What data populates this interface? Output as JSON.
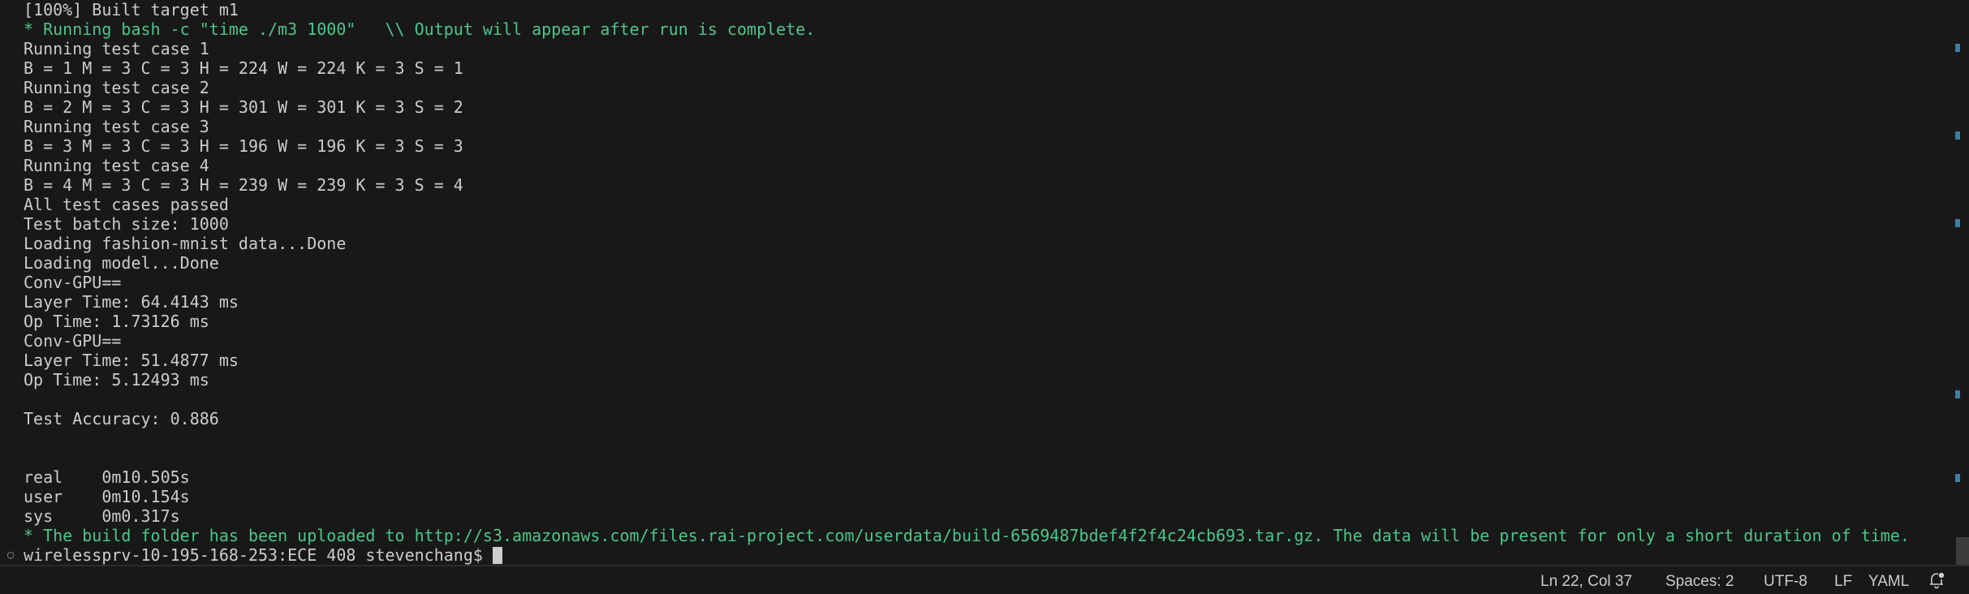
{
  "terminal": {
    "lines": [
      {
        "text": "[100%] Built target m1",
        "color": "default"
      },
      {
        "text": "* Running bash -c \"time ./m3 1000\"   \\\\ Output will appear after run is complete.",
        "color": "green"
      },
      {
        "text": "Running test case 1",
        "color": "default"
      },
      {
        "text": "B = 1 M = 3 C = 3 H = 224 W = 224 K = 3 S = 1",
        "color": "default"
      },
      {
        "text": "Running test case 2",
        "color": "default"
      },
      {
        "text": "B = 2 M = 3 C = 3 H = 301 W = 301 K = 3 S = 2",
        "color": "default"
      },
      {
        "text": "Running test case 3",
        "color": "default"
      },
      {
        "text": "B = 3 M = 3 C = 3 H = 196 W = 196 K = 3 S = 3",
        "color": "default"
      },
      {
        "text": "Running test case 4",
        "color": "default"
      },
      {
        "text": "B = 4 M = 3 C = 3 H = 239 W = 239 K = 3 S = 4",
        "color": "default"
      },
      {
        "text": "All test cases passed",
        "color": "default"
      },
      {
        "text": "Test batch size: 1000",
        "color": "default"
      },
      {
        "text": "Loading fashion-mnist data...Done",
        "color": "default"
      },
      {
        "text": "Loading model...Done",
        "color": "default"
      },
      {
        "text": "Conv-GPU==",
        "color": "default"
      },
      {
        "text": "Layer Time: 64.4143 ms",
        "color": "default"
      },
      {
        "text": "Op Time: 1.73126 ms",
        "color": "default"
      },
      {
        "text": "Conv-GPU==",
        "color": "default"
      },
      {
        "text": "Layer Time: 51.4877 ms",
        "color": "default"
      },
      {
        "text": "Op Time: 5.12493 ms",
        "color": "default"
      },
      {
        "text": "",
        "color": "default"
      },
      {
        "text": "Test Accuracy: 0.886",
        "color": "default"
      },
      {
        "text": "",
        "color": "default"
      },
      {
        "text": "",
        "color": "default"
      },
      {
        "text": "real    0m10.505s",
        "color": "default"
      },
      {
        "text": "user    0m10.154s",
        "color": "default"
      },
      {
        "text": "sys     0m0.317s",
        "color": "default"
      },
      {
        "text": "* The build folder has been uploaded to http://s3.amazonaws.com/files.rai-project.com/userdata/build-6569487bdef4f2f4c24cb693.tar.gz. The data will be present for only a short duration of time.",
        "color": "green"
      }
    ],
    "prompt": "wirelessprv-10-195-168-253:ECE 408 stevenchang$",
    "prompt_marker_icon": "circle-outline-icon"
  },
  "status_bar": {
    "position": "Ln 22, Col 37",
    "indentation": "Spaces: 2",
    "encoding": "UTF-8",
    "eol": "LF",
    "language": "YAML",
    "notifications_icon": "bell-dot-icon"
  },
  "colors": {
    "background": "#181818",
    "text": "#cccccc",
    "green": "#4ec58a",
    "scroll_marker": "#3b7ea6"
  }
}
